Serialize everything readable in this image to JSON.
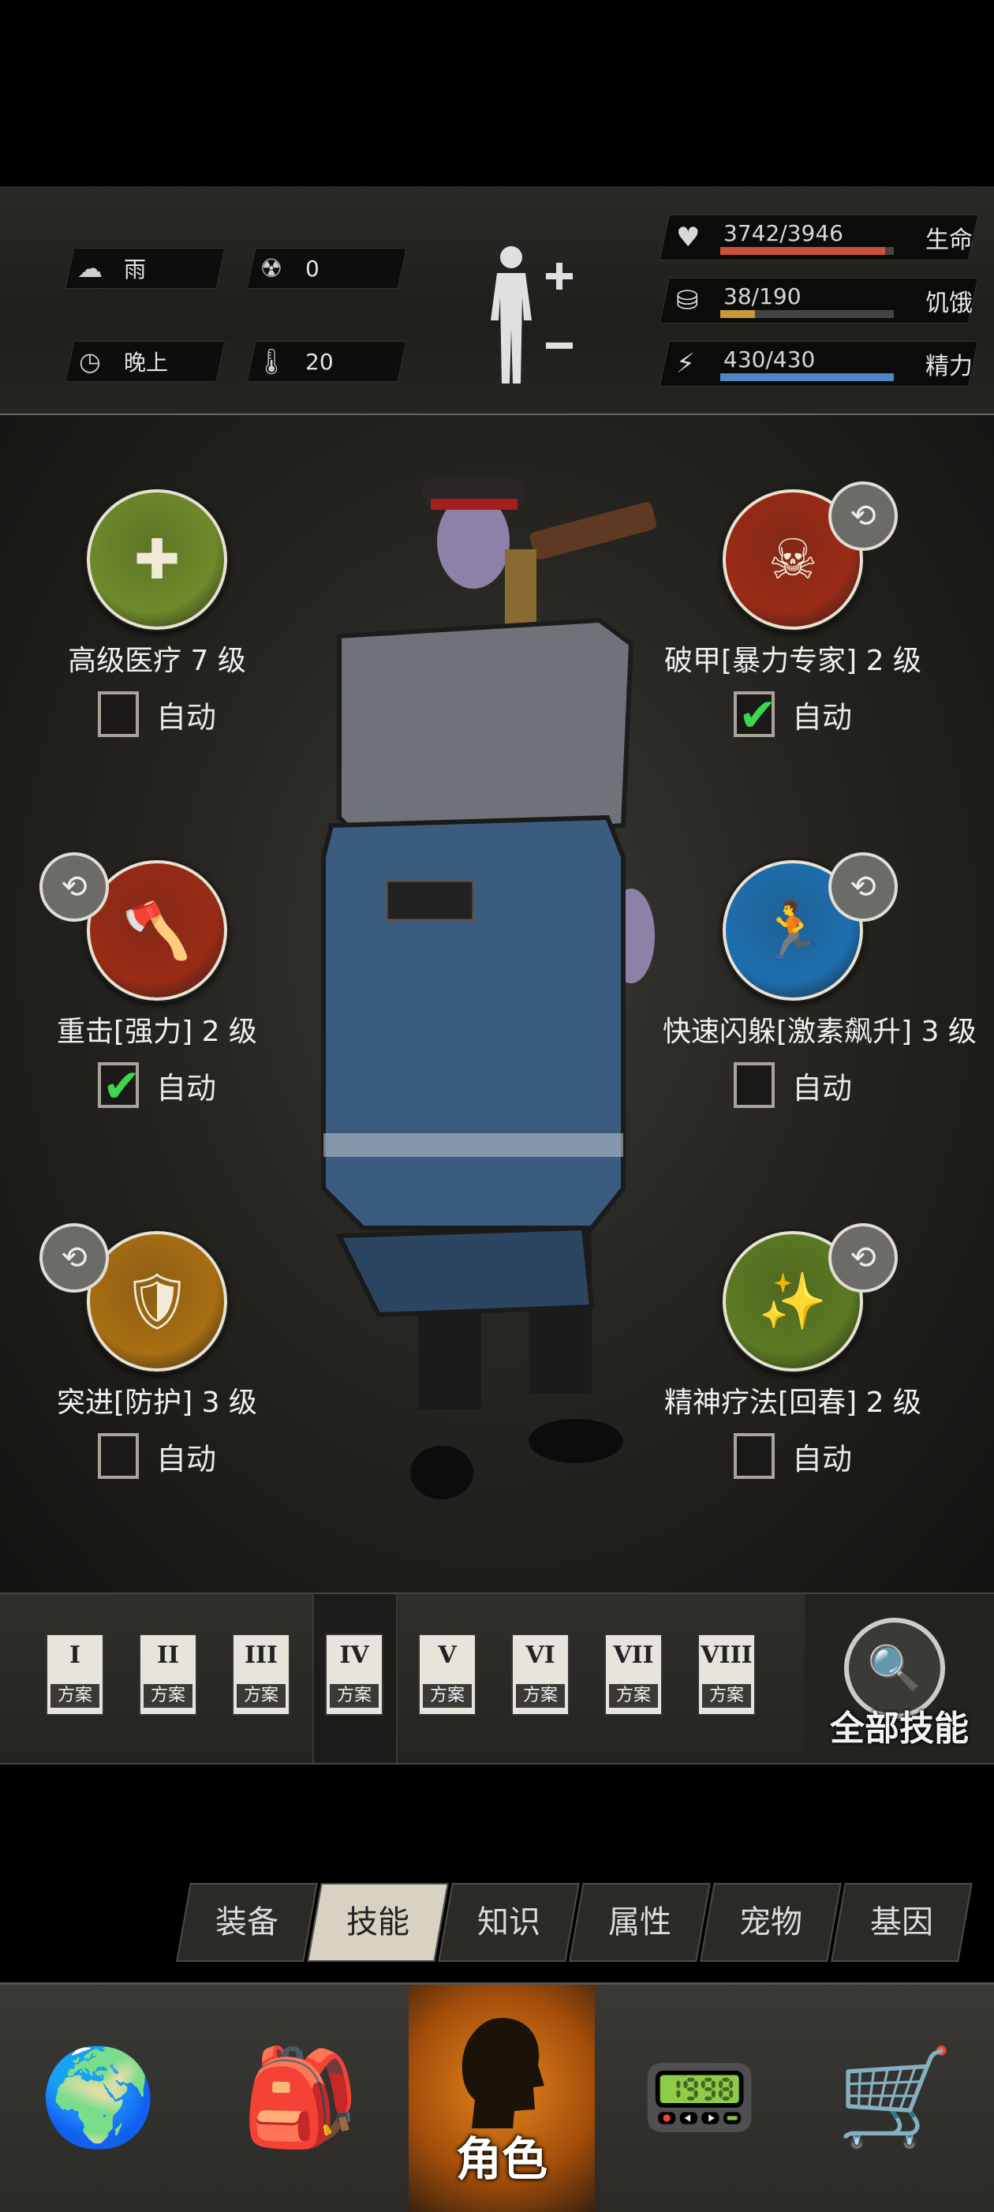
{
  "status": {
    "weather": {
      "icon": "rain-cloud-icon",
      "value": "雨"
    },
    "radiation": {
      "icon": "radiation-icon",
      "value": "0"
    },
    "time": {
      "icon": "clock-icon",
      "value": "晚上"
    },
    "temperature": {
      "icon": "thermometer-icon",
      "value": "20"
    }
  },
  "vitals": [
    {
      "name": "生命",
      "text": "3742/3946",
      "fraction": 0.948,
      "color": "#c9503a",
      "icon": "heart-rate-icon"
    },
    {
      "name": "饥饿",
      "text": "38/190",
      "fraction": 0.2,
      "color": "#c89a3a",
      "icon": "stomach-icon"
    },
    {
      "name": "精力",
      "text": "430/430",
      "fraction": 1.0,
      "color": "#4f86c2",
      "icon": "energy-head-icon"
    }
  ],
  "skills": {
    "left": [
      {
        "label": "高级医疗 7 级",
        "auto": false,
        "swap": false,
        "color": "#6f8a2a",
        "icon": "medical-kit-icon",
        "glyph": "✚"
      },
      {
        "label": "重击[强力] 2 级",
        "auto": true,
        "swap": true,
        "color": "#9a2b16",
        "icon": "axe-strike-icon",
        "glyph": "🪓"
      },
      {
        "label": "突进[防护] 3 级",
        "auto": false,
        "swap": true,
        "color": "#a86e12",
        "icon": "shield-rush-icon",
        "glyph": "🛡"
      }
    ],
    "right": [
      {
        "label": "破甲[暴力专家] 2 级",
        "auto": true,
        "swap": true,
        "color": "#9a2b16",
        "icon": "skull-crossbones-icon",
        "glyph": "☠"
      },
      {
        "label": "快速闪躲[激素飙升] 3 级",
        "auto": false,
        "swap": true,
        "color": "#1d6fb0",
        "icon": "dodge-icon",
        "glyph": "🏃"
      },
      {
        "label": "精神疗法[回春] 2 级",
        "auto": false,
        "swap": true,
        "color": "#5c7a22",
        "icon": "mind-heal-icon",
        "glyph": "✨"
      }
    ],
    "auto_label": "自动"
  },
  "plans": {
    "items": [
      "I",
      "II",
      "III",
      "IV",
      "V",
      "VI",
      "VII",
      "VIII"
    ],
    "label": "方案",
    "active_index": 3
  },
  "all_skills": {
    "label": "全部技能",
    "icon": "document-search-icon"
  },
  "tabs": {
    "items": [
      "装备",
      "技能",
      "知识",
      "属性",
      "宠物",
      "基因"
    ],
    "active_index": 1
  },
  "nav": {
    "map_icon": "globe-icon",
    "bag_icon": "backpack-icon",
    "character_label": "角色",
    "character_icon": "head-silhouette-icon",
    "radio_icon": "walkie-talkie-icon",
    "shop_icon": "shopping-cart-icon"
  }
}
